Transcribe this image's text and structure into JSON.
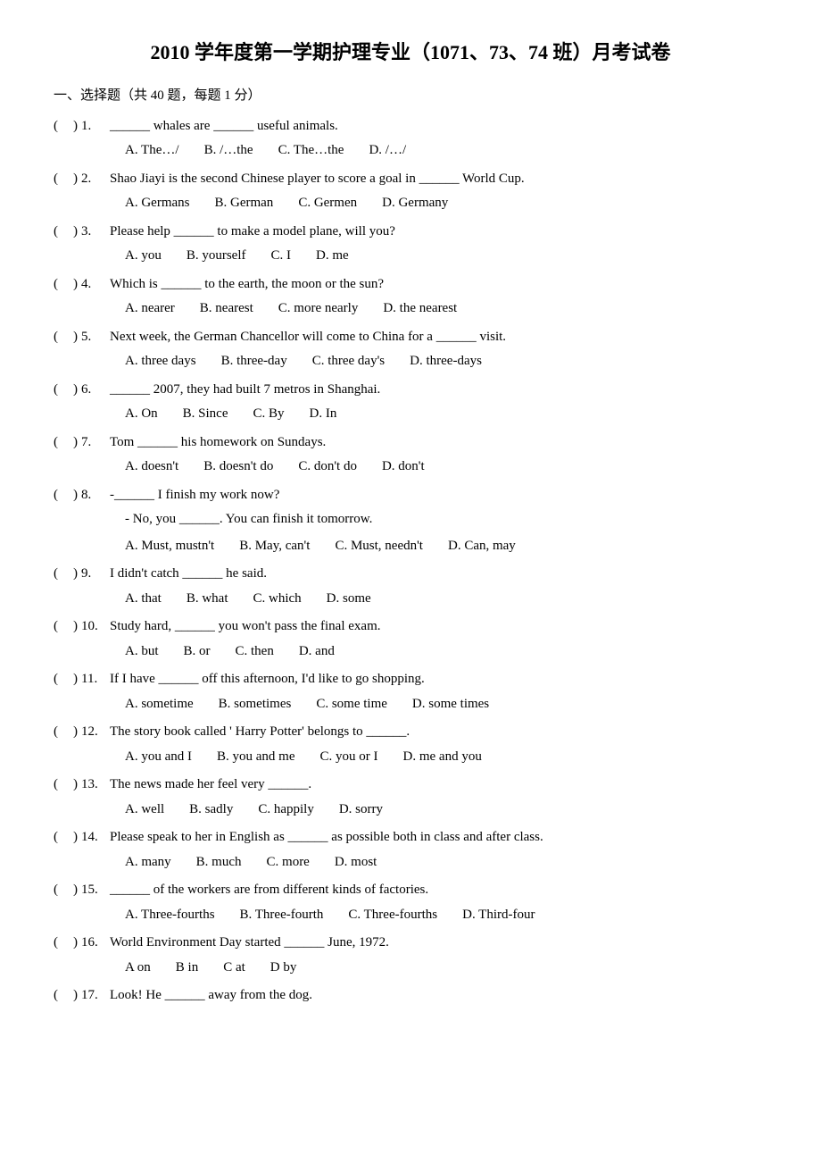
{
  "title": "2010 学年度第一学期护理专业（1071、73、74 班）月考试卷",
  "section1_header": "一、选择题（共 40 题，每题 1 分）",
  "questions": [
    {
      "num": "1.",
      "text": "______ whales are ______ useful animals.",
      "options": [
        "A. The…/",
        "B. /…the",
        "C. The…the",
        "D. /…/"
      ]
    },
    {
      "num": "2.",
      "text": "Shao Jiayi is the second Chinese player to score a goal in ______ World Cup.",
      "options": [
        "A. Germans",
        "B. German",
        "C. Germen",
        "D. Germany"
      ]
    },
    {
      "num": "3.",
      "text": "Please help ______ to make a model plane, will you?",
      "options": [
        "A. you",
        "B. yourself",
        "C. I",
        "D. me"
      ]
    },
    {
      "num": "4.",
      "text": "Which is ______ to the earth, the moon or the sun?",
      "options": [
        "A. nearer",
        "B. nearest",
        "C. more nearly",
        "D. the nearest"
      ]
    },
    {
      "num": "5.",
      "text": "Next week, the German Chancellor will come to China for a ______ visit.",
      "options": [
        "A. three days",
        "B. three-day",
        "C. three day's",
        "D. three-days"
      ]
    },
    {
      "num": "6.",
      "text": "______ 2007, they had built 7 metros in Shanghai.",
      "options": [
        "A. On",
        "B. Since",
        "C. By",
        "D. In"
      ]
    },
    {
      "num": "7.",
      "text": "Tom ______ his homework on Sundays.",
      "options": [
        "A. doesn't",
        "B. doesn't do",
        "C. don't do",
        "D. don't"
      ]
    },
    {
      "num": "8.",
      "text": "-______ I finish my work now?",
      "subtext": "- No, you ______. You can finish it tomorrow.",
      "options": [
        "A. Must, mustn't",
        "B. May, can't",
        "C. Must, needn't",
        "D. Can, may"
      ]
    },
    {
      "num": "9.",
      "text": "I didn't catch ______ he said.",
      "options": [
        "A. that",
        "B. what",
        "C. which",
        "D. some"
      ]
    },
    {
      "num": "10.",
      "text": "Study hard, ______ you won't pass the final exam.",
      "options": [
        "A. but",
        "B. or",
        "C. then",
        "D. and"
      ]
    },
    {
      "num": "11.",
      "text": "If I have ______ off this afternoon, I'd like to go shopping.",
      "options": [
        "A. sometime",
        "B. sometimes",
        "C. some time",
        "D. some times"
      ]
    },
    {
      "num": "12.",
      "text": "The story book called ' Harry Potter' belongs to ______.",
      "options": [
        "A. you and I",
        "B. you and me",
        "C. you or I",
        "D. me and you"
      ]
    },
    {
      "num": "13.",
      "text": "The news made her feel very ______.",
      "options": [
        "A. well",
        "B. sadly",
        "C. happily",
        "D. sorry"
      ]
    },
    {
      "num": "14.",
      "text": "Please speak to her in English as ______ as possible both in class and after class.",
      "options": [
        "A. many",
        "B. much",
        "C. more",
        "D. most"
      ]
    },
    {
      "num": "15.",
      "text": "______ of the workers are from different kinds of factories.",
      "options": [
        "A. Three-fourths",
        "B. Three-fourth",
        "C. Three-fourths",
        "D. Third-four"
      ]
    },
    {
      "num": "16.",
      "text": "World Environment Day started ______ June, 1972.",
      "options": [
        "A on",
        "B in",
        "C at",
        "D by"
      ]
    },
    {
      "num": "17.",
      "text": "Look! He ______ away from the dog.",
      "options": []
    }
  ]
}
